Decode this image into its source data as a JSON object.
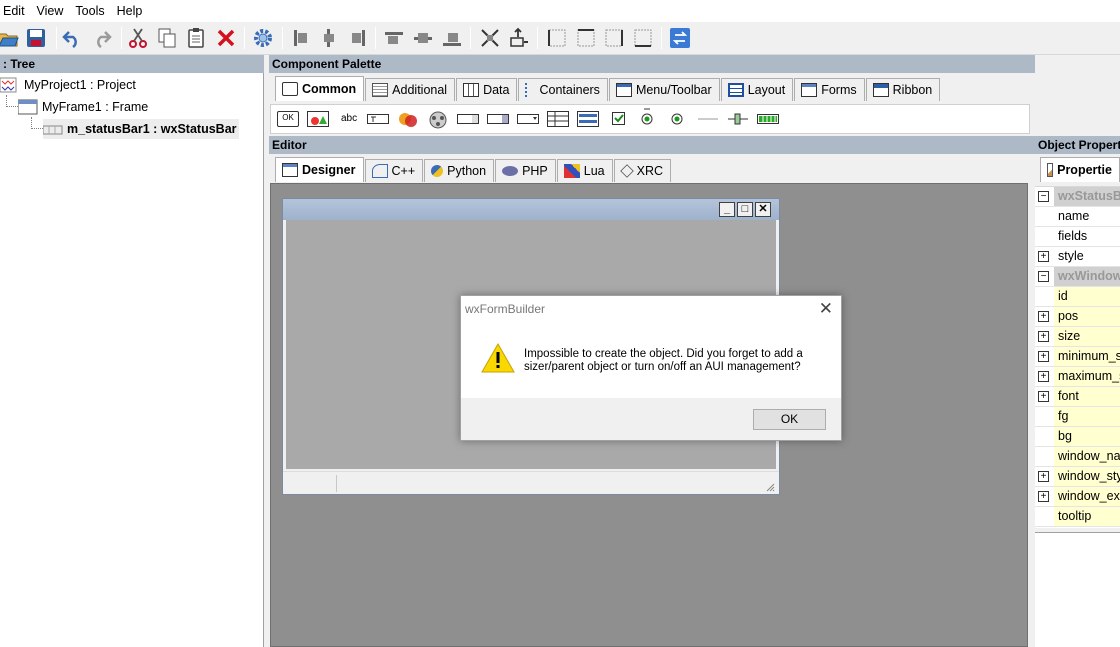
{
  "menu": [
    "Edit",
    "View",
    "Tools",
    "Help"
  ],
  "tree": {
    "title": ": Tree",
    "items": [
      {
        "label": "MyProject1 : Project"
      },
      {
        "label": "MyFrame1 : Frame"
      },
      {
        "label": "m_statusBar1 : wxStatusBar"
      }
    ]
  },
  "palette": {
    "title": "Component Palette",
    "tabs": [
      "Common",
      "Additional",
      "Data",
      "Containers",
      "Menu/Toolbar",
      "Layout",
      "Forms",
      "Ribbon"
    ],
    "text_item": "abc",
    "button_item": "OK"
  },
  "editor": {
    "title": "Editor",
    "tabs": [
      "Designer",
      "C++",
      "Python",
      "PHP",
      "Lua",
      "XRC"
    ]
  },
  "dialog": {
    "title": "wxFormBuilder",
    "message": "Impossible to create the object. Did you forget to add a sizer/parent object or turn on/off an AUI management?",
    "ok_label": "OK"
  },
  "properties": {
    "title": "Object Properti",
    "tab": "Propertie",
    "rows": [
      {
        "name": "wxStatusBa",
        "kind": "cat",
        "exp": "−"
      },
      {
        "name": "name",
        "kind": "white",
        "exp": ""
      },
      {
        "name": "fields",
        "kind": "white",
        "exp": ""
      },
      {
        "name": "style",
        "kind": "white",
        "exp": "+"
      },
      {
        "name": "wxWindow",
        "kind": "cat",
        "exp": "−"
      },
      {
        "name": "id",
        "kind": "yellow",
        "exp": ""
      },
      {
        "name": "pos",
        "kind": "yellow",
        "exp": "+"
      },
      {
        "name": "size",
        "kind": "yellow",
        "exp": "+"
      },
      {
        "name": "minimum_s",
        "kind": "yellow",
        "exp": "+"
      },
      {
        "name": "maximum_s",
        "kind": "yellow",
        "exp": "+"
      },
      {
        "name": "font",
        "kind": "yellow",
        "exp": "+"
      },
      {
        "name": "fg",
        "kind": "yellow",
        "exp": ""
      },
      {
        "name": "bg",
        "kind": "yellow",
        "exp": ""
      },
      {
        "name": "window_na",
        "kind": "yellow",
        "exp": ""
      },
      {
        "name": "window_sty",
        "kind": "yellow",
        "exp": "+"
      },
      {
        "name": "window_ext",
        "kind": "yellow",
        "exp": "+"
      },
      {
        "name": "tooltip",
        "kind": "yellow",
        "exp": ""
      }
    ]
  },
  "colors": {
    "panel_header": "#aeb9c8",
    "canvas": "#8f8f8f",
    "frame_client": "#a9a9a9",
    "prop_yellow": "#ffffd0"
  }
}
